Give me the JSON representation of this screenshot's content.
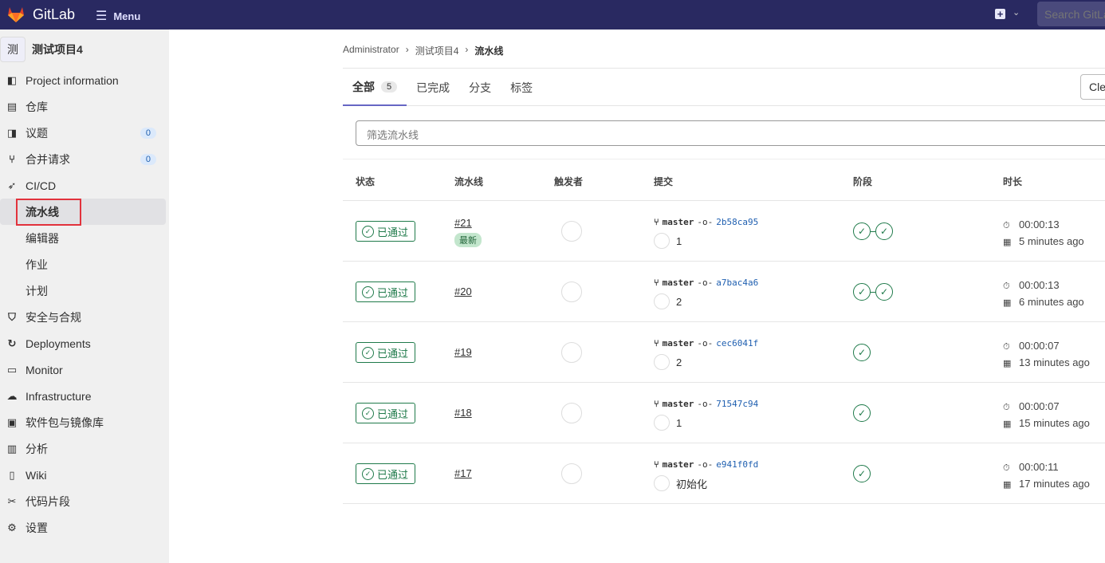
{
  "topbar": {
    "brand": "GitLab",
    "menu": "Menu",
    "search_placeholder": "Search GitLab",
    "brand_color": "#292961"
  },
  "sidebar": {
    "avatar": "测",
    "project": "测试项目4",
    "items": [
      {
        "label": "Project information",
        "icon": "project-icon"
      },
      {
        "label": "仓库",
        "icon": "doc-icon"
      },
      {
        "label": "议题",
        "icon": "issues-icon",
        "badge": "0"
      },
      {
        "label": "合并请求",
        "icon": "merge-request-icon",
        "badge": "0"
      },
      {
        "label": "CI/CD",
        "icon": "rocket-icon"
      },
      {
        "label": "流水线",
        "sub": true,
        "active": true
      },
      {
        "label": "编辑器",
        "sub": true
      },
      {
        "label": "作业",
        "sub": true
      },
      {
        "label": "计划",
        "sub": true
      },
      {
        "label": "安全与合规",
        "icon": "shield-icon"
      },
      {
        "label": "Deployments",
        "icon": "deployments-icon"
      },
      {
        "label": "Monitor",
        "icon": "monitor-icon"
      },
      {
        "label": "Infrastructure",
        "icon": "cloud-icon"
      },
      {
        "label": "软件包与镜像库",
        "icon": "package-icon"
      },
      {
        "label": "分析",
        "icon": "chart-icon"
      },
      {
        "label": "Wiki",
        "icon": "book-icon"
      },
      {
        "label": "代码片段",
        "icon": "snippet-icon"
      },
      {
        "label": "设置",
        "icon": "gear-icon"
      }
    ]
  },
  "breadcrumb": [
    "Administrator",
    "测试项目4",
    "流水线"
  ],
  "tabs": [
    {
      "label": "全部",
      "count": "5"
    },
    {
      "label": "已完成"
    },
    {
      "label": "分支"
    },
    {
      "label": "标签"
    }
  ],
  "clear_button": "Clear runner caches",
  "filter_placeholder": "筛选流水线",
  "columns": [
    "状态",
    "流水线",
    "触发者",
    "提交",
    "阶段",
    "时长"
  ],
  "rows": [
    {
      "status": "已通过",
      "id": "#21",
      "latest": "最新",
      "branch": "master",
      "sha": "2b58ca95",
      "message": "1",
      "stages": 2,
      "duration": "00:00:13",
      "finished": "5 minutes ago"
    },
    {
      "status": "已通过",
      "id": "#20",
      "branch": "master",
      "sha": "a7bac4a6",
      "message": "2",
      "stages": 2,
      "duration": "00:00:13",
      "finished": "6 minutes ago"
    },
    {
      "status": "已通过",
      "id": "#19",
      "branch": "master",
      "sha": "cec6041f",
      "message": "2",
      "stages": 1,
      "duration": "00:00:07",
      "finished": "13 minutes ago"
    },
    {
      "status": "已通过",
      "id": "#18",
      "branch": "master",
      "sha": "71547c94",
      "message": "1",
      "stages": 1,
      "duration": "00:00:07",
      "finished": "15 minutes ago"
    },
    {
      "status": "已通过",
      "id": "#17",
      "branch": "master",
      "sha": "e941f0fd",
      "message": "初始化",
      "stages": 1,
      "duration": "00:00:11",
      "finished": "17 minutes ago"
    }
  ]
}
